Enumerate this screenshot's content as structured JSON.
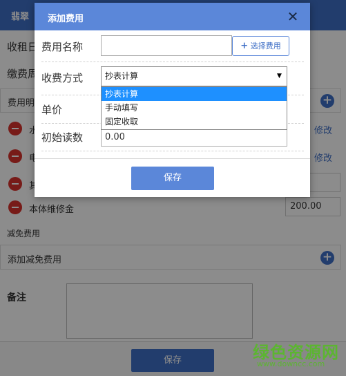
{
  "background": {
    "header_title": "翡翠",
    "label_rent_day": "收租日",
    "label_payment": "缴费周",
    "fee_detail_row": "费用明",
    "fees": [
      {
        "name": "水",
        "edit": "修改"
      },
      {
        "name": "电",
        "edit": "修改"
      },
      {
        "name": "其",
        "amount": ""
      },
      {
        "name": "本体维修金",
        "amount": "200.00"
      }
    ],
    "reduction_label": "减免费用",
    "add_reduction": "添加减免费用",
    "remark_label": "备注",
    "save_label": "保存"
  },
  "modal": {
    "title": "添加费用",
    "close_symbol": "✕",
    "fee_name_label": "费用名称",
    "fee_name_value": "",
    "choose_fee_button": "选择费用",
    "charge_method_label": "收费方式",
    "charge_method_selected": "抄表计算",
    "charge_method_options": [
      "抄表计算",
      "手动填写",
      "固定收取"
    ],
    "unit_price_label": "单价",
    "initial_reading_label": "初始读数",
    "initial_reading_value": "0.00",
    "save_label": "保存"
  },
  "watermark": {
    "main": "绿色资源网",
    "url": "www.downcc.com"
  },
  "colors": {
    "primary": "#5b87d9",
    "header_blue": "#3f6fc6",
    "danger": "#d9322c",
    "selected_option": "#1e90ff",
    "watermark_green": "#5cb531"
  }
}
